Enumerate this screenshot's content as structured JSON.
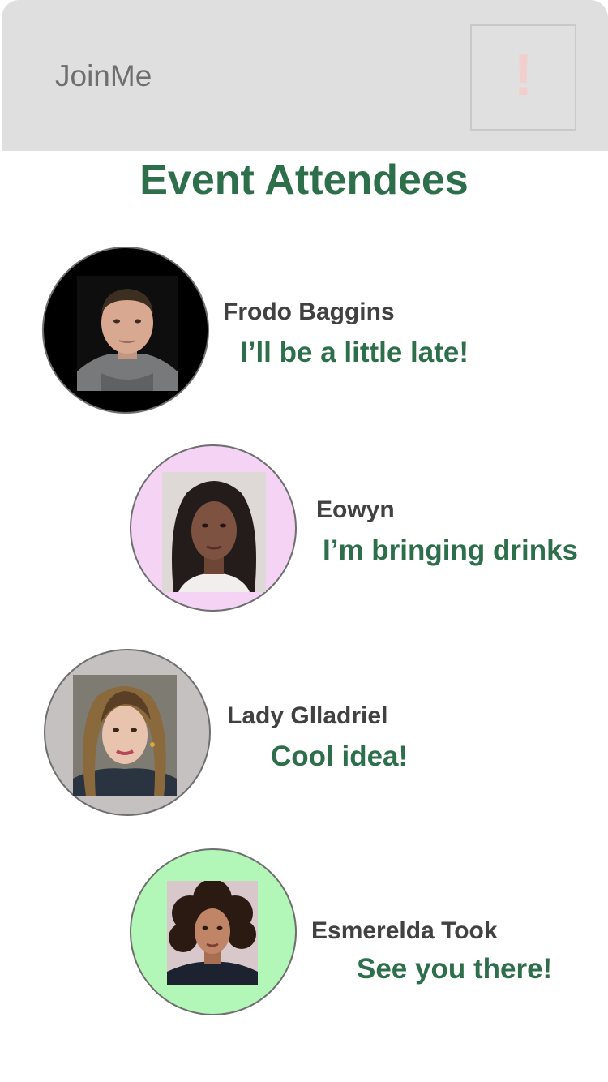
{
  "header": {
    "app_title": "JoinMe",
    "alert_label": "!"
  },
  "page": {
    "title": "Event Attendees"
  },
  "colors": {
    "accent_green": "#2d6f4b",
    "header_bg": "#dfdfdf",
    "alert_glyph": "#f1cfcd"
  },
  "attendees": [
    {
      "name": "Frodo Baggins",
      "message": "I’ll be a little late!",
      "avatar_bg": "#000000",
      "icon": "profile-photo"
    },
    {
      "name": "Eowyn",
      "message": "I’m bringing drinks",
      "avatar_bg": "#f5d3f5",
      "icon": "profile-photo"
    },
    {
      "name": "Lady Glladriel",
      "message": "Cool idea!",
      "avatar_bg": "#c5c1c1",
      "icon": "profile-photo"
    },
    {
      "name": "Esmerelda Took",
      "message": "See you there!",
      "avatar_bg": "#b3f7b8",
      "icon": "profile-photo"
    }
  ]
}
